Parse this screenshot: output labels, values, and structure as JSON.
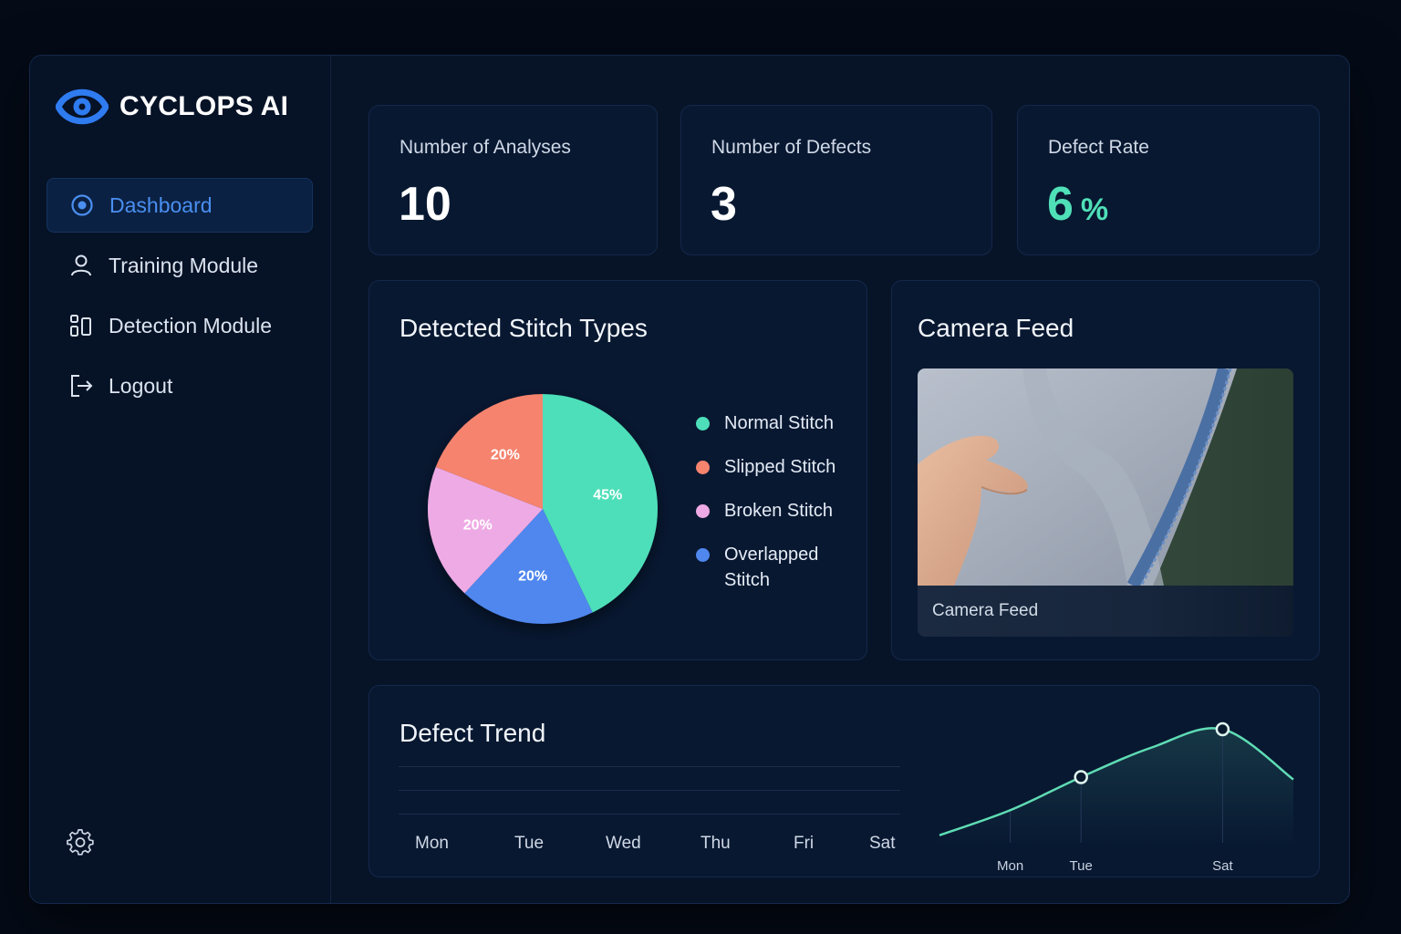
{
  "app": {
    "name": "CYCLOPS AI"
  },
  "sidebar": {
    "items": [
      {
        "label": "Dashboard",
        "icon": "target-icon",
        "active": true
      },
      {
        "label": "Training Module",
        "icon": "user-icon",
        "active": false
      },
      {
        "label": "Detection Module",
        "icon": "grid-icon",
        "active": false
      },
      {
        "label": "Logout",
        "icon": "logout-icon",
        "active": false
      }
    ],
    "settings_icon": "gear-icon"
  },
  "stats": {
    "analyses": {
      "label": "Number of Analyses",
      "value": "10"
    },
    "defects": {
      "label": "Number of Defects",
      "value": "3"
    },
    "rate": {
      "label": "Defect Rate",
      "value": "6",
      "unit": "%"
    }
  },
  "stitch_chart": {
    "title": "Detected Stitch Types",
    "legend": [
      "Normal Stitch",
      "Slipped Stitch",
      "Broken Stitch",
      "Overlapped Stitch"
    ]
  },
  "camera": {
    "title": "Camera Feed",
    "caption": "Camera Feed"
  },
  "trend": {
    "title": "Defect Trend",
    "days": [
      "Mon",
      "Tue",
      "Wed",
      "Thu",
      "Fri",
      "Sat"
    ]
  },
  "colors": {
    "accent": "#3b82f6",
    "green": "#4fe0b8",
    "normal": "#4ddfb9",
    "slipped": "#f5836e",
    "broken": "#eeaae4",
    "overlapped": "#4f87ef"
  },
  "chart_data": [
    {
      "type": "pie",
      "title": "Detected Stitch Types",
      "categories": [
        "Normal Stitch",
        "Slipped Stitch",
        "Broken Stitch",
        "Overlapped Stitch"
      ],
      "values": [
        45,
        20,
        20,
        20
      ],
      "labels": [
        "45%",
        "20%",
        "20%",
        "20%"
      ],
      "colors": [
        "#4ddfb9",
        "#f5836e",
        "#eeaae4",
        "#4f87ef"
      ],
      "legend": "right"
    },
    {
      "type": "line",
      "title": "",
      "x": [
        "",
        "Mon",
        "Tue",
        "",
        "Sat",
        ""
      ],
      "tick_labels": [
        "Mon",
        "Tue",
        "Sat"
      ],
      "values": [
        0.05,
        0.27,
        0.56,
        0.82,
        0.98,
        0.54
      ],
      "markers": [
        2,
        4
      ],
      "ylim": [
        0,
        1
      ],
      "grid": false,
      "color": "#5fdcb4"
    }
  ]
}
